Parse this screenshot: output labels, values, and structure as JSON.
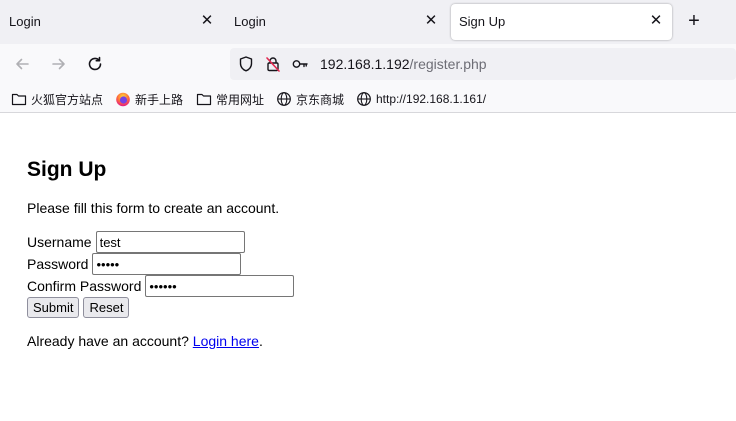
{
  "tabs": [
    {
      "label": "Login",
      "active": false
    },
    {
      "label": "Login",
      "active": false
    },
    {
      "label": "Sign Up",
      "active": true
    }
  ],
  "tab_close_glyph": "✕",
  "new_tab_glyph": "+",
  "navbar": {
    "back_icon": "arrow-left-icon",
    "forward_icon": "arrow-right-icon",
    "reload_icon": "reload-icon"
  },
  "url": {
    "host": "192.168.1.192",
    "path": "/register.php"
  },
  "bookmarks": [
    {
      "label": "火狐官方站点",
      "icon": "folder-icon"
    },
    {
      "label": "新手上路",
      "icon": "firefox-icon"
    },
    {
      "label": "常用网址",
      "icon": "folder-icon"
    },
    {
      "label": "京东商城",
      "icon": "globe-icon"
    },
    {
      "label": "http://192.168.1.161/",
      "icon": "globe-icon"
    }
  ],
  "page": {
    "heading": "Sign Up",
    "intro": "Please fill this form to create an account.",
    "username_label": "Username",
    "username_value": "test",
    "password_label": "Password",
    "password_value": "12345",
    "confirm_label": "Confirm Password",
    "confirm_value": "123456",
    "submit_label": "Submit",
    "reset_label": "Reset",
    "account_prompt": "Already have an account?",
    "login_link": "Login here",
    "login_suffix": "."
  },
  "colors": {
    "link": "#0000ee",
    "tabbar_bg": "#f0f0f4",
    "toolbar_bg": "#f9f9fb"
  }
}
